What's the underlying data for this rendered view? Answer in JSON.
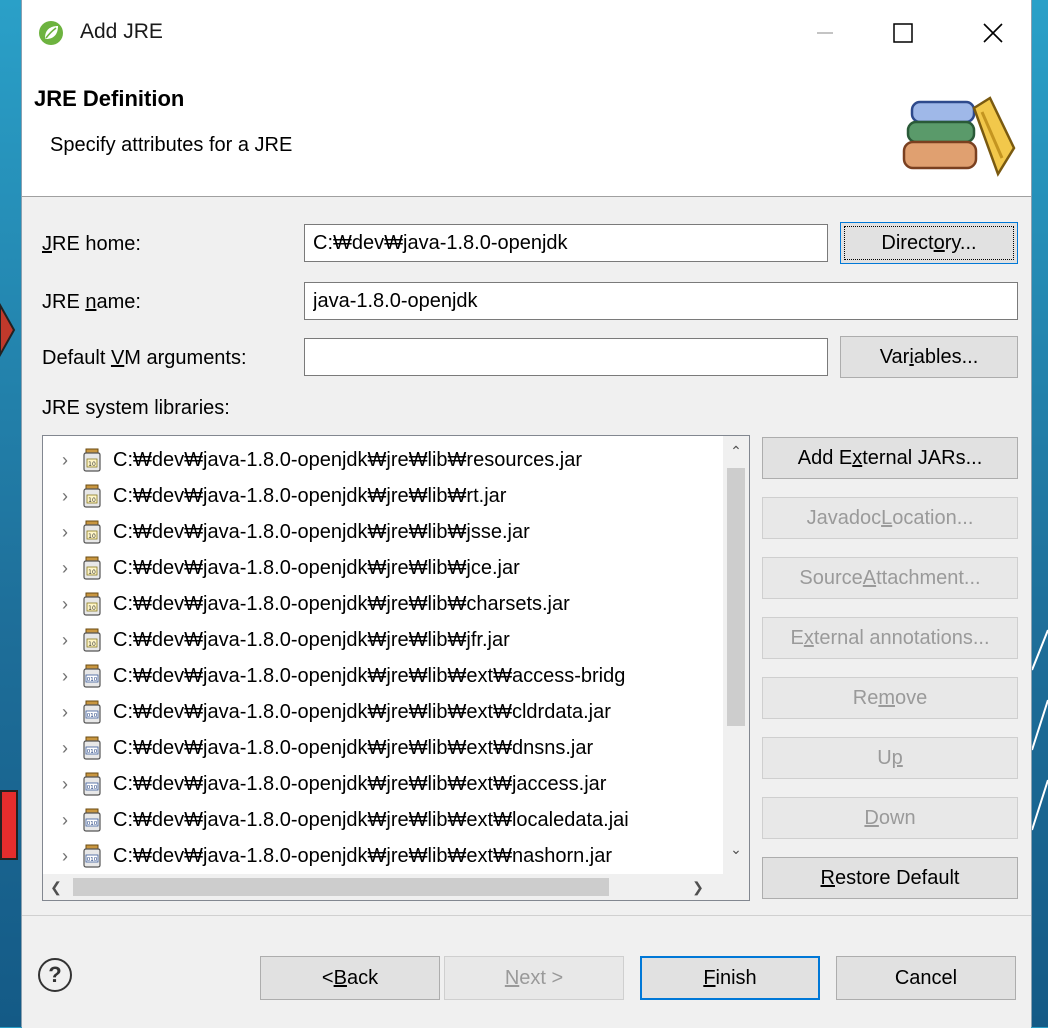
{
  "window": {
    "title": "Add JRE"
  },
  "header": {
    "title": "JRE Definition",
    "subtitle": "Specify attributes for a JRE"
  },
  "form": {
    "jre_home": {
      "label_mn": "J",
      "label_rest": "RE home:",
      "value": "C:₩dev₩java-1.8.0-openjdk",
      "button_pre": "Direct",
      "button_mn": "o",
      "button_post": "ry..."
    },
    "jre_name": {
      "label_pre": "JRE ",
      "label_mn": "n",
      "label_post": "ame:",
      "value": "java-1.8.0-openjdk"
    },
    "vm_args": {
      "label_pre": "Default ",
      "label_mn": "V",
      "label_post": "M arguments:",
      "value": "",
      "button_pre": "Var",
      "button_mn": "i",
      "button_post": "ables..."
    },
    "libs_label": "JRE system libraries:"
  },
  "libraries": [
    {
      "path": "C:₩dev₩java-1.8.0-openjdk₩jre₩lib₩resources.jar",
      "icon": "jar-source-icon"
    },
    {
      "path": "C:₩dev₩java-1.8.0-openjdk₩jre₩lib₩rt.jar",
      "icon": "jar-source-icon"
    },
    {
      "path": "C:₩dev₩java-1.8.0-openjdk₩jre₩lib₩jsse.jar",
      "icon": "jar-source-icon"
    },
    {
      "path": "C:₩dev₩java-1.8.0-openjdk₩jre₩lib₩jce.jar",
      "icon": "jar-source-icon"
    },
    {
      "path": "C:₩dev₩java-1.8.0-openjdk₩jre₩lib₩charsets.jar",
      "icon": "jar-source-icon"
    },
    {
      "path": "C:₩dev₩java-1.8.0-openjdk₩jre₩lib₩jfr.jar",
      "icon": "jar-source-icon"
    },
    {
      "path": "C:₩dev₩java-1.8.0-openjdk₩jre₩lib₩ext₩access-bridg",
      "icon": "jar-binary-icon"
    },
    {
      "path": "C:₩dev₩java-1.8.0-openjdk₩jre₩lib₩ext₩cldrdata.jar",
      "icon": "jar-binary-icon"
    },
    {
      "path": "C:₩dev₩java-1.8.0-openjdk₩jre₩lib₩ext₩dnsns.jar",
      "icon": "jar-binary-icon"
    },
    {
      "path": "C:₩dev₩java-1.8.0-openjdk₩jre₩lib₩ext₩jaccess.jar",
      "icon": "jar-binary-icon"
    },
    {
      "path": "C:₩dev₩java-1.8.0-openjdk₩jre₩lib₩ext₩localedata.jai",
      "icon": "jar-binary-icon"
    },
    {
      "path": "C:₩dev₩java-1.8.0-openjdk₩jre₩lib₩ext₩nashorn.jar",
      "icon": "jar-binary-icon"
    }
  ],
  "side_buttons": {
    "add_external": {
      "pre": "Add E",
      "mn": "x",
      "post": "ternal JARs..."
    },
    "javadoc": {
      "pre": "Javadoc ",
      "mn": "L",
      "post": "ocation..."
    },
    "source": {
      "pre": "Source ",
      "mn": "A",
      "post": "ttachment..."
    },
    "annotations": {
      "pre": "E",
      "mn": "x",
      "post": "ternal annotations..."
    },
    "remove": {
      "pre": "Re",
      "mn": "m",
      "post": "ove"
    },
    "up": {
      "pre": "U",
      "mn": "p",
      "post": ""
    },
    "down": {
      "pre": "",
      "mn": "D",
      "post": "own"
    },
    "restore": {
      "pre": "",
      "mn": "R",
      "post": "estore Default"
    }
  },
  "footer": {
    "help": "?",
    "back": {
      "pre": "< ",
      "mn": "B",
      "post": "ack"
    },
    "next": {
      "pre": "",
      "mn": "N",
      "post": "ext >"
    },
    "finish": {
      "pre": "",
      "mn": "F",
      "post": "inish"
    },
    "cancel": "Cancel"
  },
  "colors": {
    "accent": "#0078d7",
    "background": "#f0f0f0",
    "disabled_text": "#9a9a9a"
  }
}
